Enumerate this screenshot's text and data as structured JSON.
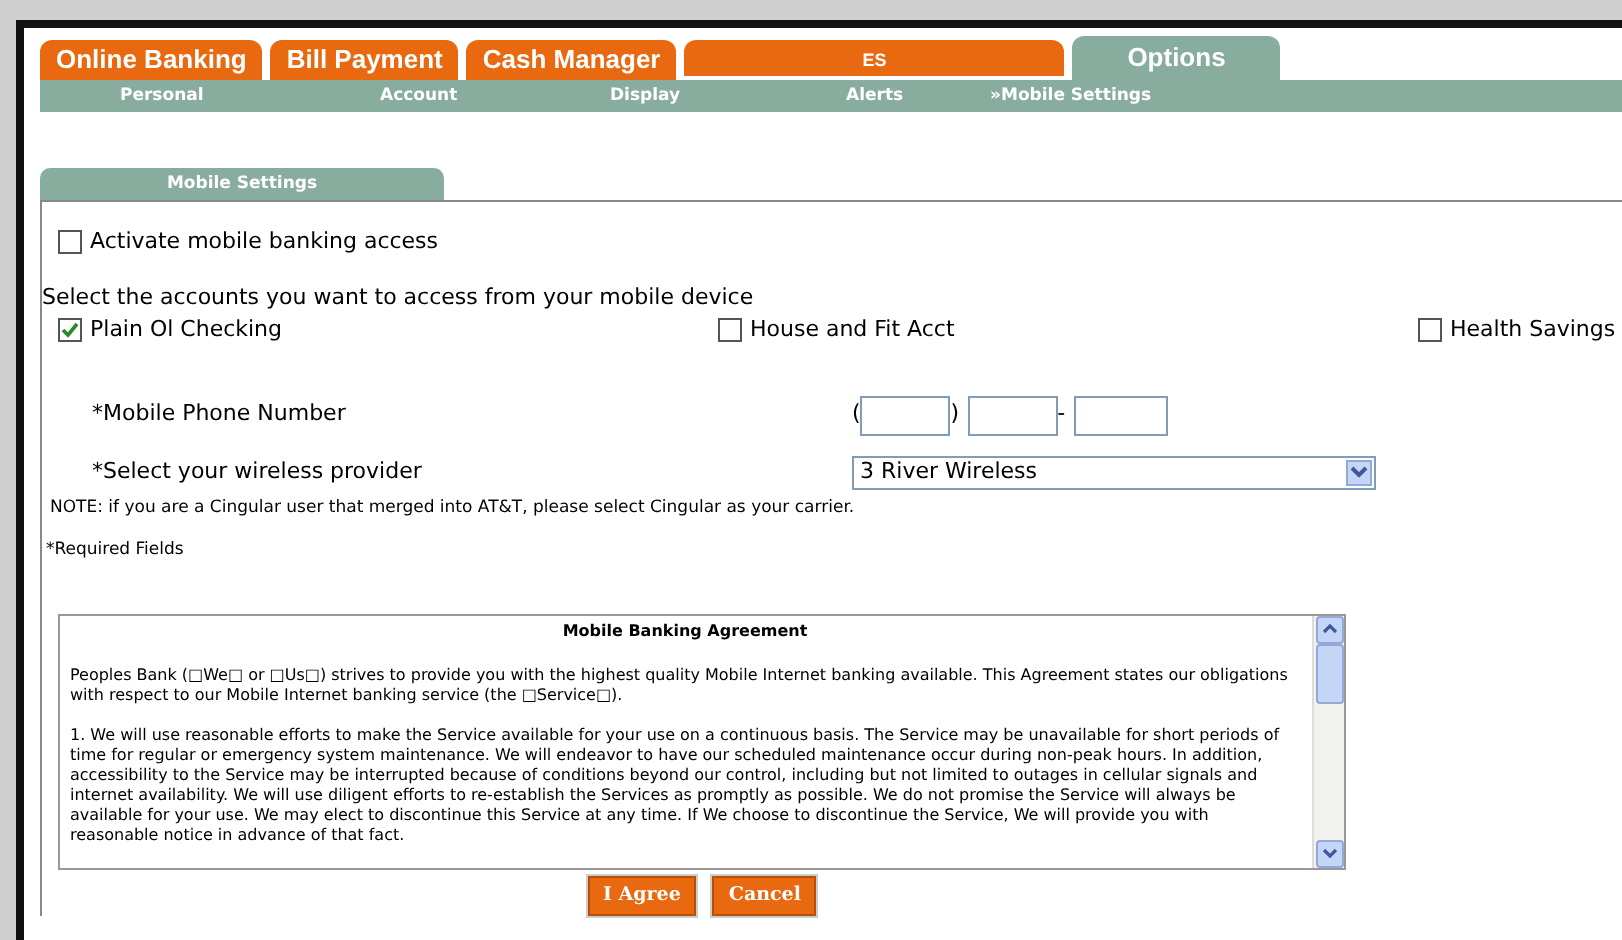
{
  "tabs": [
    {
      "label": "Online Banking",
      "selected": false
    },
    {
      "label": "Bill Payment",
      "selected": false
    },
    {
      "label": "Cash Manager",
      "selected": false
    },
    {
      "label": "ES",
      "selected": false
    },
    {
      "label": "Options",
      "selected": true
    }
  ],
  "subnav": [
    "Personal",
    "Account",
    "Display",
    "Alerts",
    "»Mobile Settings"
  ],
  "section_tab": "Mobile Settings",
  "activate": {
    "label": "Activate mobile banking access",
    "checked": false
  },
  "accounts_prompt": "Select the accounts you want to access from your mobile device",
  "accounts": [
    {
      "label": "Plain Ol Checking",
      "checked": true
    },
    {
      "label": "House and Fit Acct",
      "checked": false
    },
    {
      "label": "Health Savings",
      "checked": false
    }
  ],
  "phone": {
    "label": "*Mobile Phone Number",
    "open_paren": "(",
    "close_paren": ")",
    "dash": "-"
  },
  "provider": {
    "label": "*Select your wireless provider",
    "value": "3 River Wireless"
  },
  "note": "NOTE: if you are a Cingular user that merged into AT&T, please select Cingular as your carrier.",
  "required": "*Required Fields",
  "agreement": {
    "title": "Mobile Banking Agreement",
    "paragraphs": [
      "Peoples Bank (□We□ or □Us□) strives to provide you with the highest quality Mobile Internet banking available. This Agreement states our obligations with respect to our Mobile Internet banking service (the □Service□).",
      "1. We will use reasonable efforts to make the Service available for your use on a continuous basis. The Service may be unavailable for short periods of time for regular or emergency system maintenance. We will endeavor to have our scheduled maintenance occur during non-peak hours. In addition, accessibility to the Service may be interrupted because of conditions beyond our control, including but not limited to outages in cellular signals and internet availability. We will use diligent efforts to re-establish the Services as promptly as possible. We do not promise the Service will always be available for your use. We may elect to discontinue this Service at any time. If We choose to discontinue the Service, We will provide you with reasonable notice in advance of that fact."
    ]
  },
  "buttons": [
    "I Agree",
    "Cancel"
  ]
}
